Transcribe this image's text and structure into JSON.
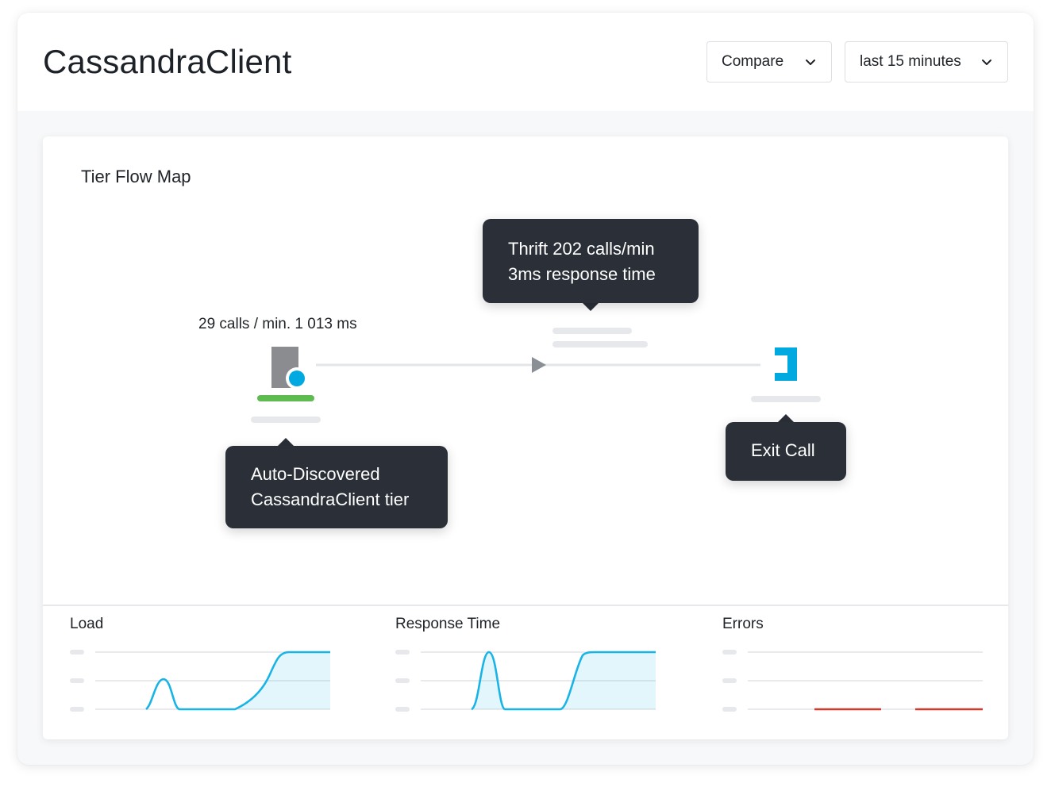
{
  "app": {
    "title": "CassandraClient"
  },
  "toolbar": {
    "compare_label": "Compare",
    "time_range_label": "last 15 minutes"
  },
  "flow_map": {
    "title": "Tier Flow Map",
    "tier_stats": "29 calls / min. 1 013 ms",
    "thrift_tooltip": {
      "line1": "Thrift 202 calls/min",
      "line2": "3ms response time"
    },
    "tier_tooltip": {
      "line1": "Auto-Discovered",
      "line2": "CassandraClient tier"
    },
    "exit_tooltip": "Exit Call",
    "icons": {
      "tier": "tier-node-icon",
      "exit": "exit-call-icon",
      "arrow": "flow-arrow-icon"
    },
    "colors": {
      "health_ok": "#5dbb4f",
      "accent": "#00a9e0",
      "tooltip_bg": "#2a2f38"
    }
  },
  "metrics": {
    "load_title": "Load",
    "response_title": "Response Time",
    "errors_title": "Errors",
    "line_color": "#19b4e6",
    "error_color": "#d33a2c"
  }
}
